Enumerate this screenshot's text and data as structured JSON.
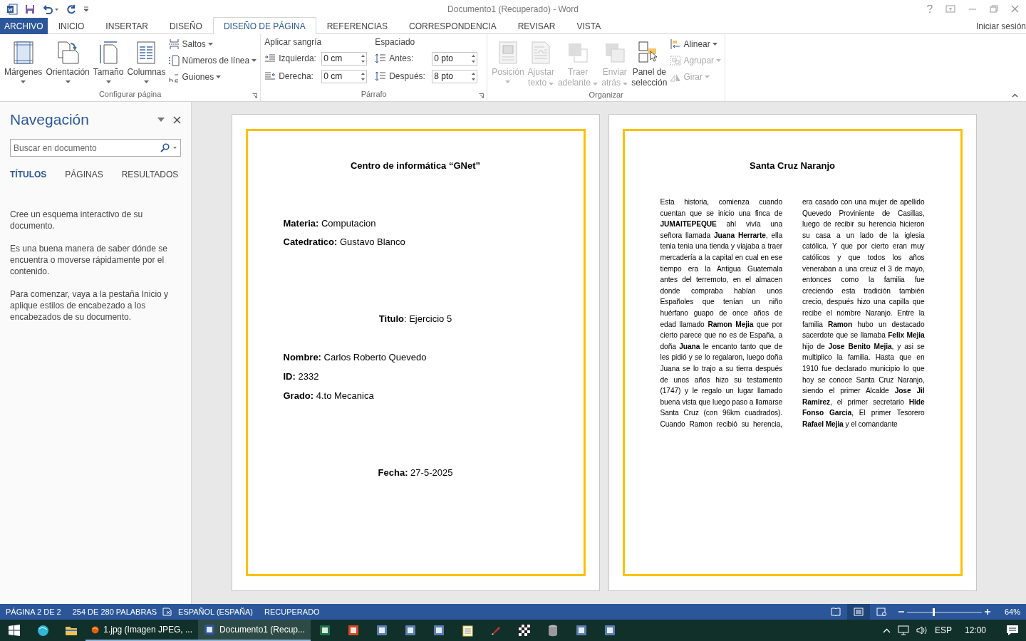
{
  "title_bar": {
    "title": "Documento1 (Recuperado) - Word"
  },
  "ribbon_tabs": [
    {
      "label": "ARCHIVO",
      "kind": "file",
      "selected": false
    },
    {
      "label": "INICIO",
      "kind": "tab",
      "selected": false
    },
    {
      "label": "INSERTAR",
      "kind": "tab",
      "selected": false
    },
    {
      "label": "DISEÑO",
      "kind": "tab",
      "selected": false
    },
    {
      "label": "DISEÑO DE PÁGINA",
      "kind": "tab",
      "selected": true
    },
    {
      "label": "REFERENCIAS",
      "kind": "tab",
      "selected": false
    },
    {
      "label": "CORRESPONDENCIA",
      "kind": "tab",
      "selected": false
    },
    {
      "label": "REVISAR",
      "kind": "tab",
      "selected": false
    },
    {
      "label": "VISTA",
      "kind": "tab",
      "selected": false
    }
  ],
  "account": "Iniciar sesión",
  "ribbon_groups": [
    {
      "kind": "buttons",
      "label": "Configurar página",
      "launcher": true,
      "large_buttons": [
        {
          "kind": "margins",
          "lines": [
            "Márgenes"
          ],
          "has_menu": true,
          "disabled": false
        },
        {
          "kind": "orientation",
          "lines": [
            "Orientación"
          ],
          "has_menu": true,
          "disabled": false
        },
        {
          "kind": "size",
          "lines": [
            "Tamaño"
          ],
          "has_menu": true,
          "disabled": false
        },
        {
          "kind": "columns",
          "lines": [
            "Columnas"
          ],
          "has_menu": true,
          "disabled": false
        }
      ],
      "small_buttons": [
        {
          "kind": "breaks",
          "label": "Saltos",
          "disabled": false
        },
        {
          "kind": "line-numbers",
          "label": "Números de línea",
          "disabled": false
        },
        {
          "kind": "hyphenation",
          "label": "Guiones",
          "disabled": false
        }
      ]
    },
    {
      "kind": "paragraph",
      "label": "Párrafo",
      "launcher": true,
      "sections": [
        {
          "heading": "Aplicar sangría",
          "fields": [
            {
              "kind": "indent-left",
              "label": "Izquierda:",
              "value": "0 cm"
            },
            {
              "kind": "indent-right",
              "label": "Derecha:",
              "value": "0 cm"
            }
          ]
        },
        {
          "heading": "Espaciado",
          "fields": [
            {
              "kind": "space-before",
              "label": "Antes:",
              "value": "0 pto"
            },
            {
              "kind": "space-after",
              "label": "Después:",
              "value": "8 pto"
            }
          ]
        }
      ]
    },
    {
      "kind": "buttons",
      "label": "Organizar",
      "launcher": false,
      "large_buttons": [
        {
          "kind": "position",
          "lines": [
            "Posición"
          ],
          "has_menu": true,
          "disabled": true
        },
        {
          "kind": "wrap",
          "lines": [
            "Ajustar",
            "texto"
          ],
          "has_menu": true,
          "disabled": true
        },
        {
          "kind": "forward",
          "lines": [
            "Traer",
            "adelante"
          ],
          "has_menu": true,
          "disabled": true
        },
        {
          "kind": "backward",
          "lines": [
            "Enviar",
            "atrás"
          ],
          "has_menu": true,
          "disabled": true
        },
        {
          "kind": "selection-pane",
          "lines": [
            "Panel de",
            "selección"
          ],
          "has_menu": false,
          "disabled": false
        }
      ],
      "small_buttons": [
        {
          "kind": "align",
          "label": "Alinear",
          "disabled": false
        },
        {
          "kind": "group",
          "label": "Agrupar",
          "disabled": true
        },
        {
          "kind": "rotate",
          "label": "Girar",
          "disabled": true
        }
      ]
    }
  ],
  "navigation": {
    "title": "Navegación",
    "search_placeholder": "Buscar en documento",
    "tabs": [
      {
        "label": "TÍTULOS",
        "selected": true
      },
      {
        "label": "PÁGINAS",
        "selected": false
      },
      {
        "label": "RESULTADOS",
        "selected": false
      }
    ],
    "paragraphs": [
      "Cree un esquema interactivo de su documento.",
      "Es una buena manera de saber dónde se encuentra o moverse rápidamente por el contenido.",
      "Para comenzar, vaya a la pestaña Inicio y aplique estilos de encabezado a los encabezados de su documento."
    ]
  },
  "pages": [
    {
      "kind": "cover",
      "lines": [
        {
          "text": "Centro de informática “GNet”",
          "kind": "heading"
        },
        {
          "text": "**Materia:** Computacion",
          "kind": "field"
        },
        {
          "text": "**Catedratico:** Gustavo Blanco",
          "kind": "field"
        },
        {
          "text": "**Titulo**: Ejercicio 5",
          "kind": "centered-field"
        },
        {
          "text": "**Nombre:** Carlos Roberto Quevedo",
          "kind": "field"
        },
        {
          "text": "**ID:** 2332",
          "kind": "field"
        },
        {
          "text": "**Grado:** 4.to Mecanica",
          "kind": "field"
        },
        {
          "text": "**Fecha:** 27-5-2025",
          "kind": "centered-field"
        }
      ]
    },
    {
      "kind": "article",
      "title": "Santa Cruz Naranjo",
      "body": "Esta historia, comienza cuando cuentan que se inicio una finca de **JUMAITEPEQUE** ahí vivía una señora llamada **Juana Herrarte**, ella tenia tenia una tienda y viajaba a traer mercadería a la capital en cual en ese tiempo era la Antigua Guatemala antes del terremoto, en el almacen donde compraba habían unos Españoles que tenían un niño huérfano guapo de once años de edad llamado **Ramon Mejia** que por cierto parece que no es de España, a doña **Juana** le encanto tanto que de les pidió y se lo regalaron, luego doña Juana se lo trajo a su tierra después de unos años hizo su testamento (1747) y le regalo un lugar llamado buena vista que luego paso a llamarse Santa Cruz (con 96km cuadrados). Cuando Ramon recibió su herencia, era casado con una mujer de apellido Quevedo Proviniente de Casillas, luego de recibir su herencia hicieron su casa a un lado de la iglesia católica. Y que por cierto eran muy católicos y que todos los años veneraban a una creuz el 3 de mayo, entonces como la familia fue creciendo esta tradición también crecio, después hizo una capilla que recibe el nombre Naranjo. Entre la familia **Ramon** hubo un destacado sacerdote que se llamaba **Felix Mejia** hijo de **Jose Benito Mejia**, y asi se multiplico la familia. Hasta que en 1910 fue declarado municipio lo que hoy se conoce Santa Cruz Naranjo, siendo el primer Alcalde **Jose Jil Ramirez**, el primer secretario **Hide Fonso Garcia**, El primer Tesorero **Rafael Mejia** y el comandante"
    }
  ],
  "status_bar": {
    "page": "PÁGINA 2 DE 2",
    "words": "254 DE 280 PALABRAS",
    "language": "ESPAÑOL (ESPAÑA)",
    "state": "RECUPERADO",
    "views": [
      {
        "kind": "read",
        "selected": false
      },
      {
        "kind": "print",
        "selected": true
      },
      {
        "kind": "web",
        "selected": false
      }
    ],
    "zoom": {
      "level": 0.35,
      "label": "64%"
    }
  },
  "taskbar": {
    "pinned_before": [
      {
        "kind": "browser"
      },
      {
        "kind": "folder"
      }
    ],
    "apps": [
      {
        "kind": "firefox",
        "label": "1.jpg (Imagen JPEG, ...",
        "selected": false
      },
      {
        "kind": "word",
        "label": "Documento1 (Recup...",
        "selected": true
      }
    ],
    "pinned_after": [
      {
        "kind": "spreadsheet"
      },
      {
        "kind": "slides"
      },
      {
        "kind": "tool"
      },
      {
        "kind": "tool"
      },
      {
        "kind": "tool"
      },
      {
        "kind": "notes"
      },
      {
        "kind": "pen"
      },
      {
        "kind": "grid"
      },
      {
        "kind": "database"
      },
      {
        "kind": "tool"
      },
      {
        "kind": "tool"
      }
    ],
    "language": "ESP",
    "time": "12:00"
  }
}
